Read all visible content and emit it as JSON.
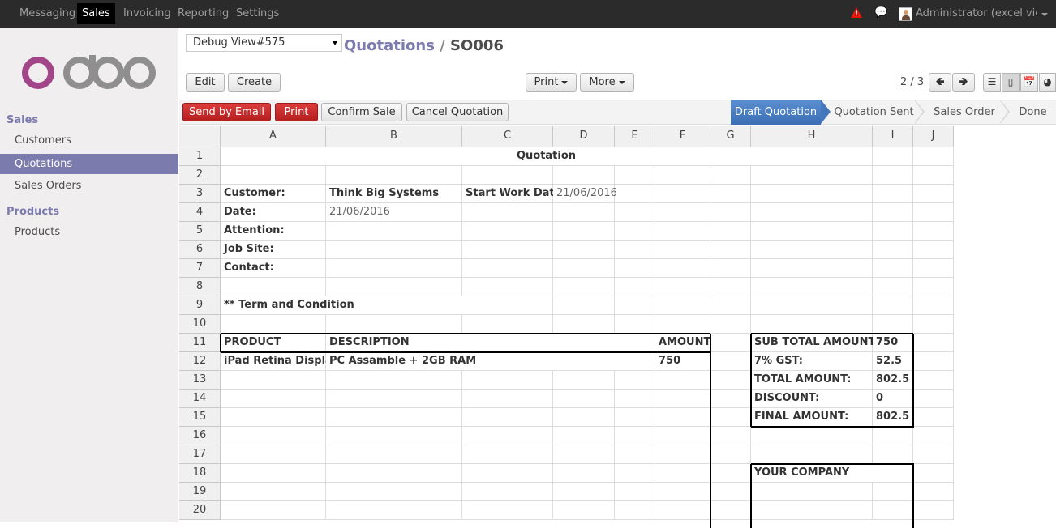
{
  "topbar": {
    "menus": [
      "Messaging",
      "Sales",
      "Invoicing",
      "Reporting",
      "Settings"
    ],
    "active_menu": "Sales",
    "user": "Administrator (excel  view"
  },
  "sidebar": {
    "sections": [
      {
        "title": "Sales",
        "items": [
          "Customers",
          "Quotations",
          "Sales Orders"
        ]
      },
      {
        "title": "Products",
        "items": [
          "Products"
        ]
      }
    ],
    "active_item": "Quotations",
    "logo_text": "odoo"
  },
  "header": {
    "view_select": "Debug View#575",
    "breadcrumb_link": "Quotations",
    "breadcrumb_sep": "/",
    "breadcrumb_current": "SO006",
    "edit": "Edit",
    "create": "Create",
    "print": "Print",
    "more": "More",
    "pager": "2 / 3"
  },
  "actions": {
    "send_email": "Send by Email",
    "print": "Print",
    "confirm": "Confirm Sale",
    "cancel": "Cancel Quotation"
  },
  "stages": [
    "Draft Quotation",
    "Quotation Sent",
    "Sales Order",
    "Done"
  ],
  "active_stage": "Draft Quotation",
  "sheet": {
    "columns": [
      "A",
      "B",
      "C",
      "D",
      "E",
      "F",
      "G",
      "H",
      "I",
      "J"
    ],
    "rows": [
      "1",
      "2",
      "3",
      "4",
      "5",
      "6",
      "7",
      "8",
      "9",
      "10",
      "11",
      "12",
      "13",
      "14",
      "15",
      "16",
      "17",
      "18",
      "19",
      "20"
    ],
    "title": "Quotation",
    "customer_label": "Customer:",
    "customer_value": "Think Big Systems",
    "start_label": "Start Work Date:",
    "start_value": "21/06/2016",
    "date_label": "Date:",
    "date_value": "21/06/2016",
    "attention_label": "Attention:",
    "jobsite_label": "Job Site:",
    "contact_label": "Contact:",
    "terms": "** Term and Condition",
    "product_header": "PRODUCT",
    "description_header": "DESCRIPTION",
    "amount_header": "AMOUNT",
    "product_value": "iPad Retina Display",
    "description_value": "PC Assamble + 2GB RAM",
    "amount_value": "750",
    "subtotal_label": "SUB TOTAL AMOUNT:",
    "subtotal_value": "750",
    "gst_label": "7% GST:",
    "gst_value": "52.5",
    "total_label": "TOTAL AMOUNT:",
    "total_value": "802.5",
    "discount_label": "DISCOUNT:",
    "discount_value": "0",
    "final_label": "FINAL AMOUNT:",
    "final_value": "802.5",
    "company": "YOUR COMPANY"
  },
  "colors": {
    "accent": "#7c7bad",
    "red": "#c9302c",
    "stage_active": "#4577bd"
  }
}
